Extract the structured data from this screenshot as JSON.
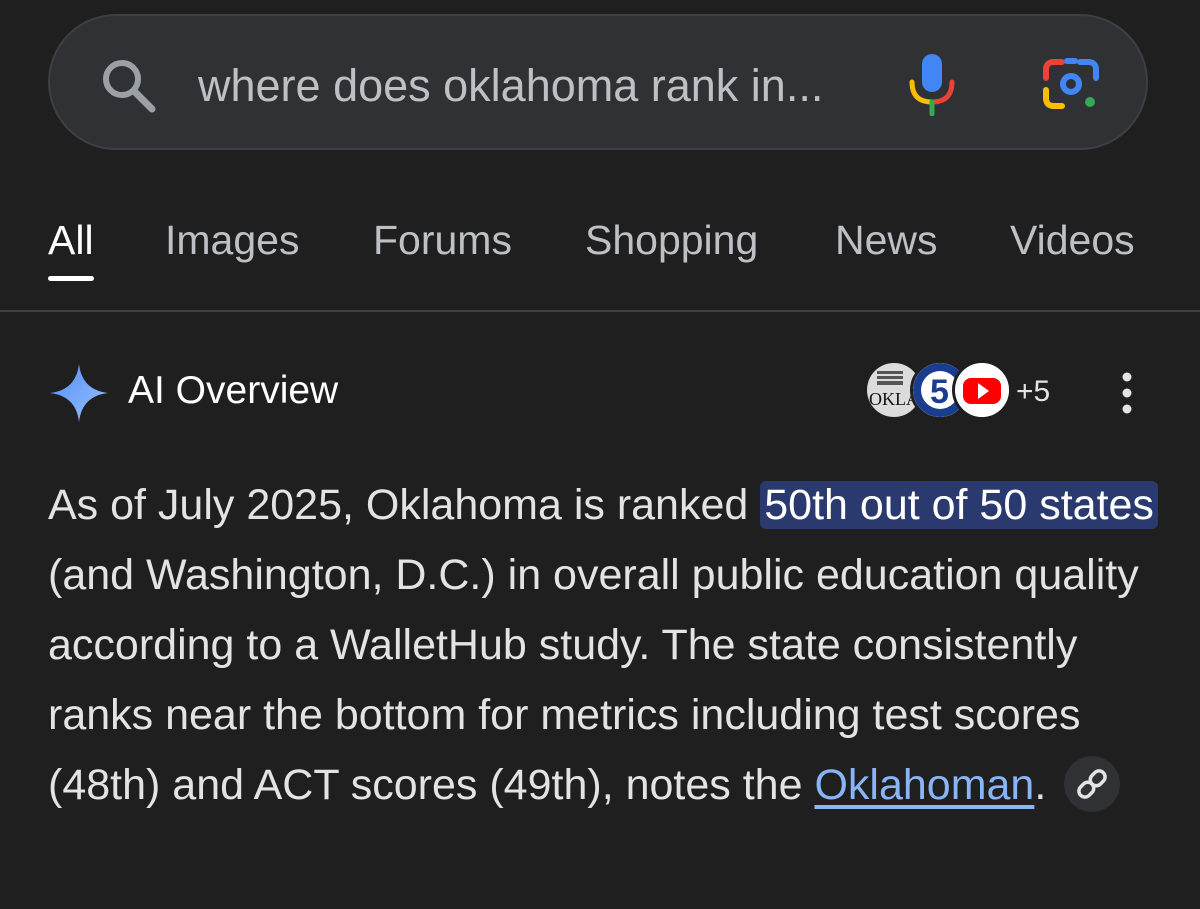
{
  "search": {
    "query": "where does oklahoma rank in...",
    "icons": [
      "search-icon",
      "mic-icon",
      "google-lens-icon"
    ]
  },
  "tabs": [
    {
      "label": "All",
      "active": true
    },
    {
      "label": "Images",
      "active": false
    },
    {
      "label": "Forums",
      "active": false
    },
    {
      "label": "Shopping",
      "active": false
    },
    {
      "label": "News",
      "active": false
    },
    {
      "label": "Videos",
      "active": false
    }
  ],
  "ai_overview": {
    "title": "AI Overview",
    "sources_more": "+5",
    "answer": {
      "part1": "As of July 2025, Oklahoma is ranked ",
      "highlight": "50th out of 50 states",
      "part2": " (and Washington, D.C.) in overall public education quality according to a WalletHub study. The state consistently ranks near the bottom for metrics including test scores (48th) and ACT scores (49th), notes the ",
      "link": "Oklahoman",
      "part3": "."
    }
  },
  "colors": {
    "background": "#1f1f1f",
    "search_bg": "#303134",
    "highlight_bg": "#2b3a6e",
    "link": "#8ab4f8",
    "sparkle": "#8ab4f8"
  }
}
